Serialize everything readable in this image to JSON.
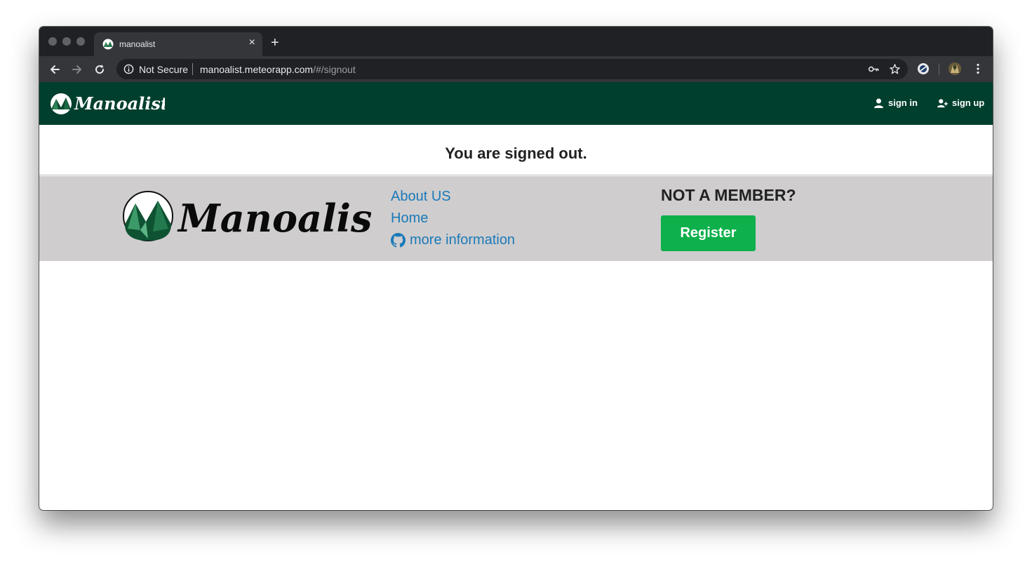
{
  "browser": {
    "tab_title": "manoalist",
    "new_tab_symbol": "+",
    "close_symbol": "×",
    "security_label": "Not Secure",
    "url_host": "manoalist.meteorapp.com",
    "url_path": "/#/signout"
  },
  "navbar": {
    "logo_text": "Manoalist",
    "sign_in": "sign in",
    "sign_up": "sign up",
    "background": "#003f2d"
  },
  "main": {
    "message": "You are signed out."
  },
  "footer": {
    "logo_text": "Manoalist",
    "links": [
      {
        "label": "About US"
      },
      {
        "label": "Home"
      },
      {
        "label": "more information",
        "icon": "github-icon"
      }
    ],
    "member_title": "NOT A MEMBER?",
    "register_label": "Register",
    "background": "#cfcdce",
    "link_color": "#1a7ab8",
    "button_color": "#0db04b"
  }
}
